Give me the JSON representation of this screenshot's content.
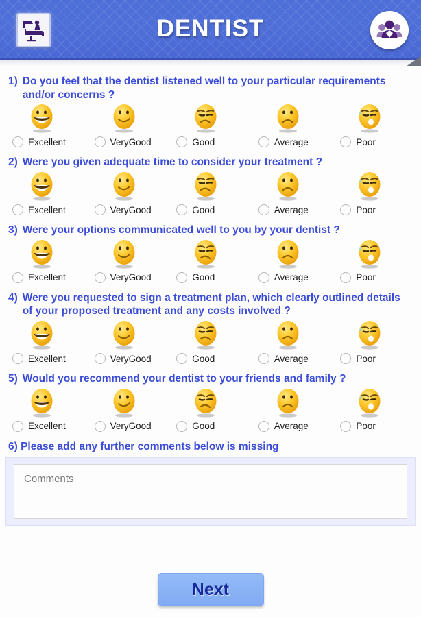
{
  "header": {
    "title": "DENTIST",
    "logo_icon": "dentist-chair-icon",
    "people_icon": "group-people-icon"
  },
  "scale_labels": [
    "Excellent",
    "VeryGood",
    "Good",
    "Average",
    "Poor"
  ],
  "scale_emojis": [
    "grinning-face",
    "smiling-face",
    "annoyed-face",
    "frowning-face",
    "sweating-face"
  ],
  "questions": [
    {
      "num": "1)",
      "text": "Do you feel that the dentist listened well to your particular requirements and/or concerns ?"
    },
    {
      "num": "2)",
      "text": "Were you given adequate time to consider your treatment ?"
    },
    {
      "num": "3)",
      "text": "Were your options communicated well to you by your dentist ?"
    },
    {
      "num": "4)",
      "text": "Were you requested to sign a treatment plan, which clearly outlined details of your proposed treatment and any costs involved ?"
    },
    {
      "num": "5)",
      "text": "Would you recommend your dentist to your friends and family ?"
    }
  ],
  "comments": {
    "question": "6) Please add any further comments below is missing",
    "placeholder": "Comments",
    "value": ""
  },
  "footer": {
    "next_label": "Next"
  },
  "colors": {
    "header_blue": "#4f6fd8",
    "question_blue": "#3b4cd8",
    "button_blue": "#8ab3f5",
    "button_text": "#162a9e",
    "emoji_yellow": "#f7b733"
  }
}
